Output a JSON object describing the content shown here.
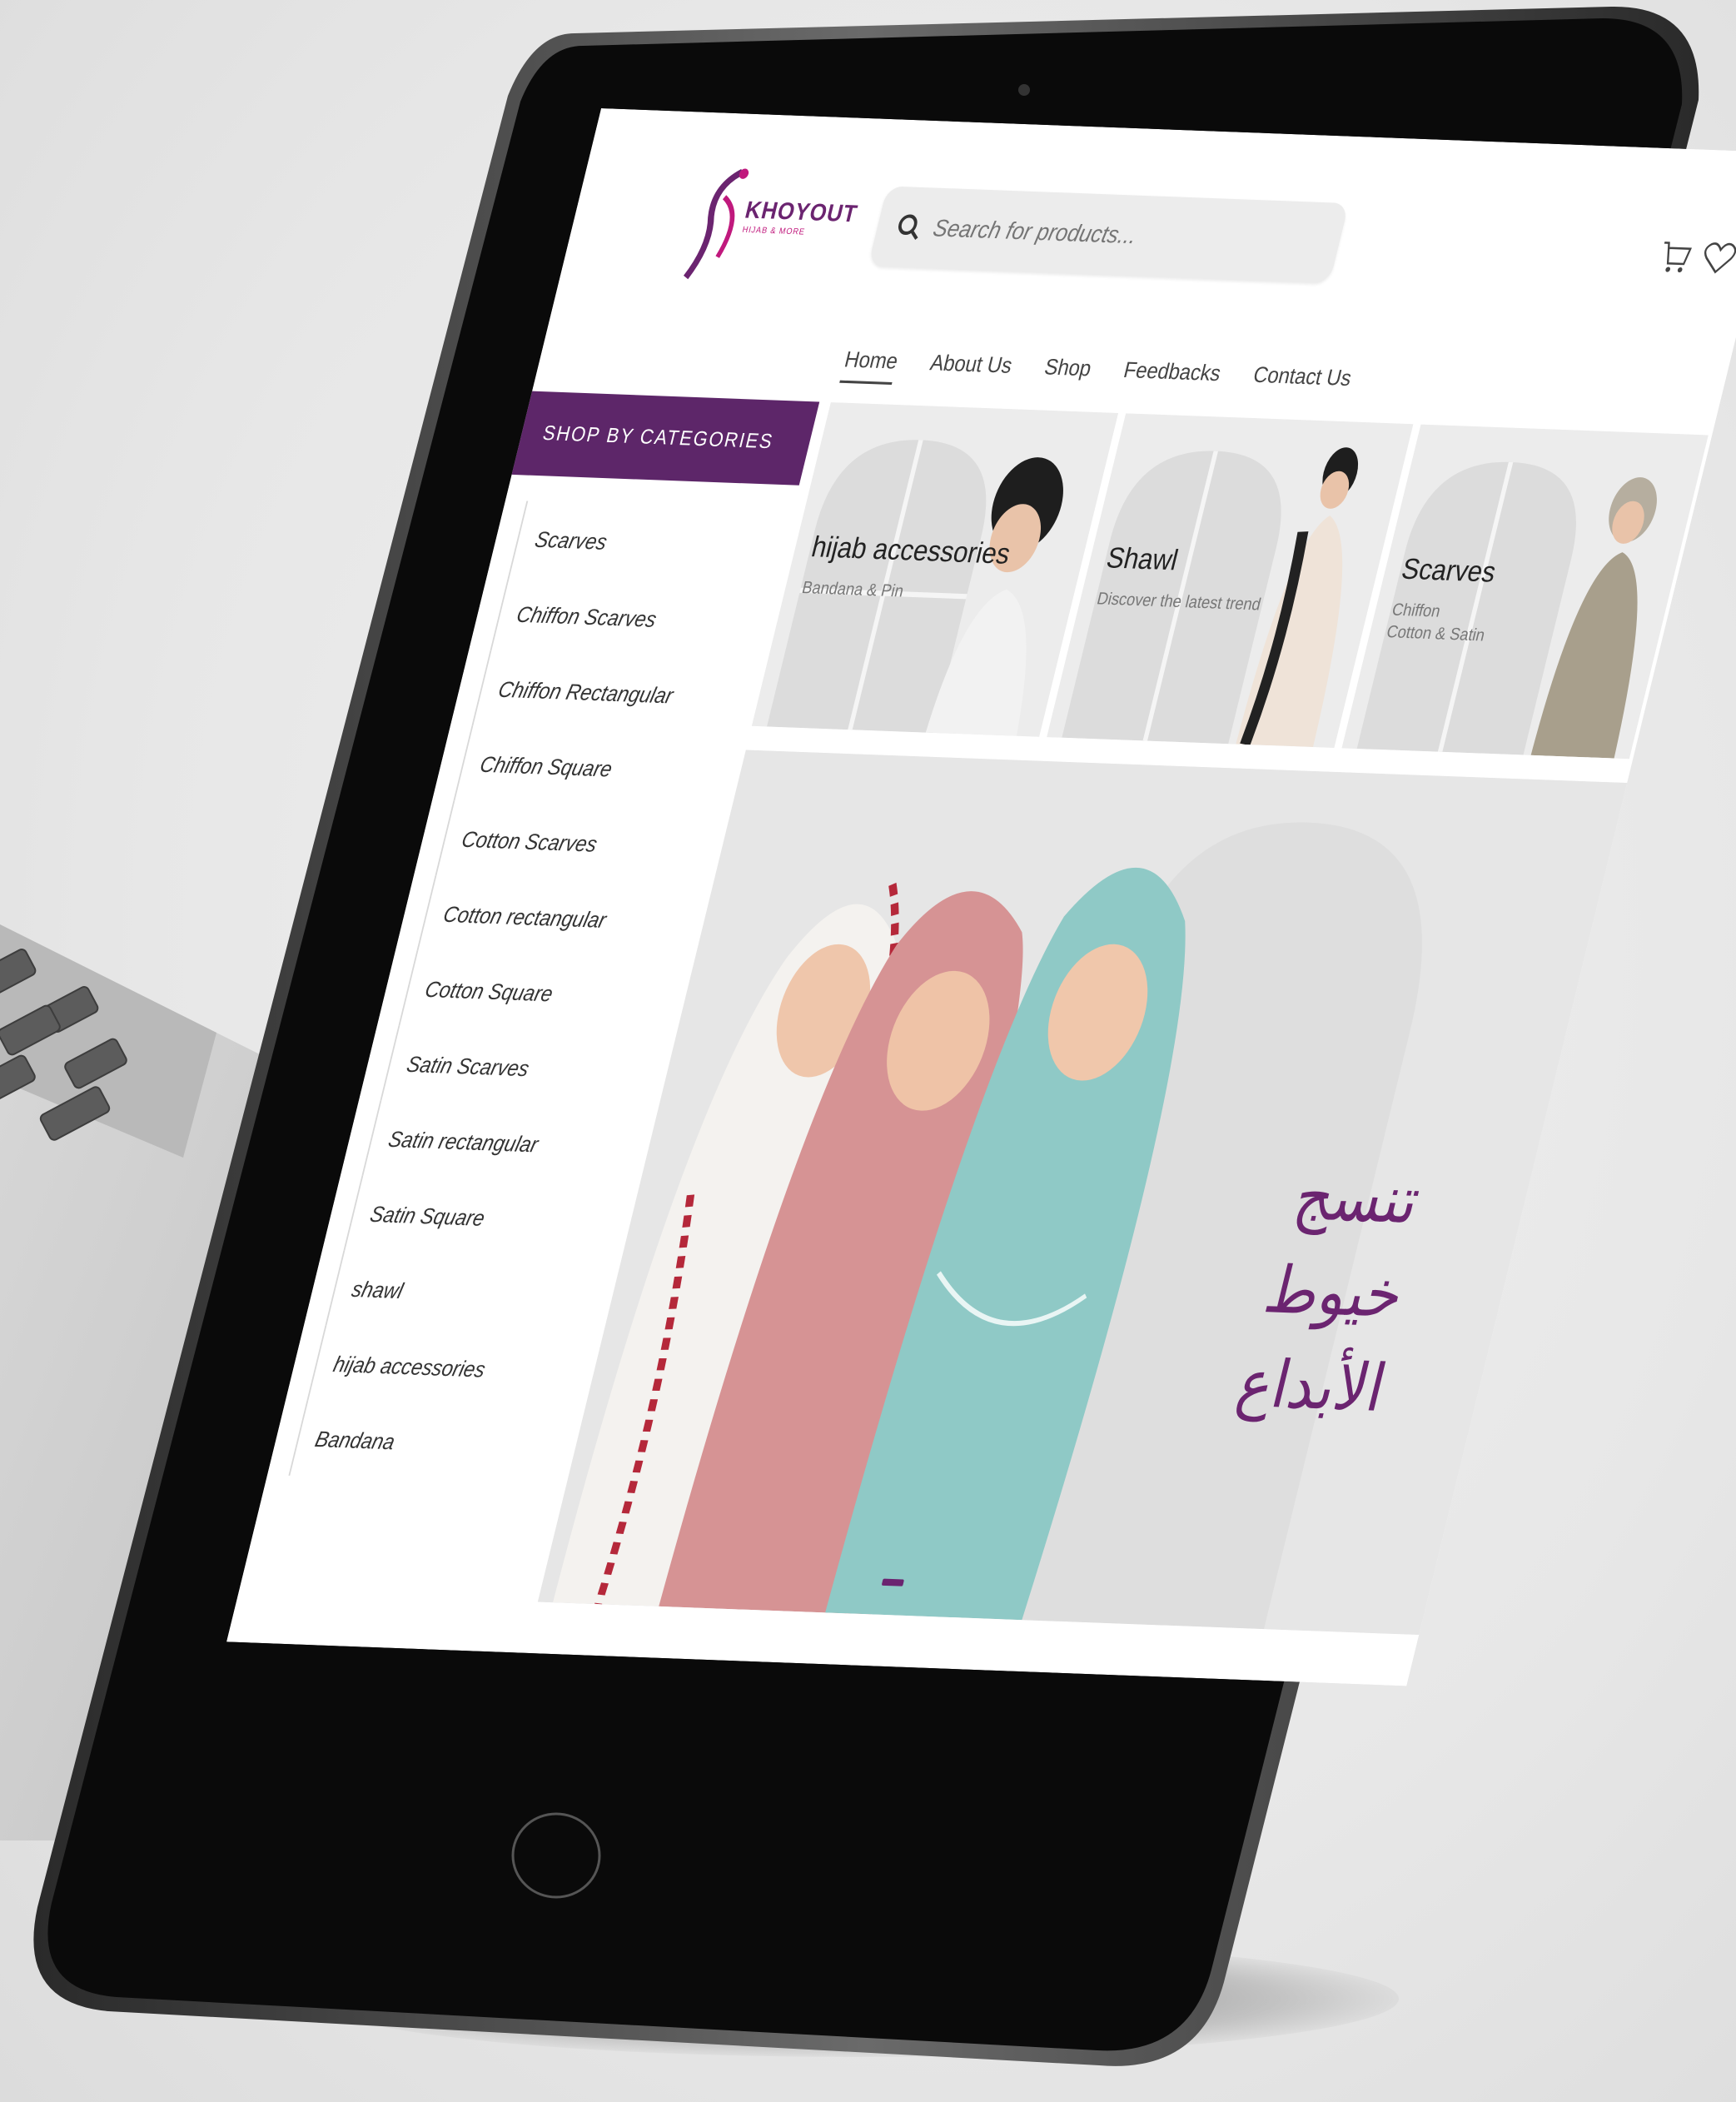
{
  "brand": {
    "name": "KHOYOUT",
    "tagline": "HIJAB & MORE",
    "primary_color": "#5d2669",
    "accent_color": "#c0197d"
  },
  "header": {
    "search_placeholder": "Search for products...",
    "cart_icon": "cart-icon",
    "wishlist_icon": "heart-icon"
  },
  "nav": {
    "items": [
      {
        "label": "Home",
        "active": true
      },
      {
        "label": "About Us",
        "active": false
      },
      {
        "label": "Shop",
        "active": false
      },
      {
        "label": "Feedbacks",
        "active": false
      },
      {
        "label": "Contact Us",
        "active": false
      }
    ]
  },
  "sidebar": {
    "title": "SHOP BY CATEGORIES",
    "items": [
      "Scarves",
      "Chiffon Scarves",
      "Chiffon Rectangular",
      "Chiffon Square",
      "Cotton Scarves",
      "Cotton rectangular",
      "Cotton Square",
      "Satin Scarves",
      "Satin rectangular",
      "Satin Square",
      "shawl",
      "hijab accessories",
      "Bandana"
    ]
  },
  "cards": [
    {
      "title": "hijab accessories",
      "sub": "Bandana & Pin"
    },
    {
      "title": "Shawl",
      "sub": "Discover the latest trend"
    },
    {
      "title": "Scarves",
      "sub": "Chiffon\nCotton & Satin"
    }
  ],
  "hero": {
    "line1": "تنسج خيوط",
    "line2": "الأبداع"
  }
}
